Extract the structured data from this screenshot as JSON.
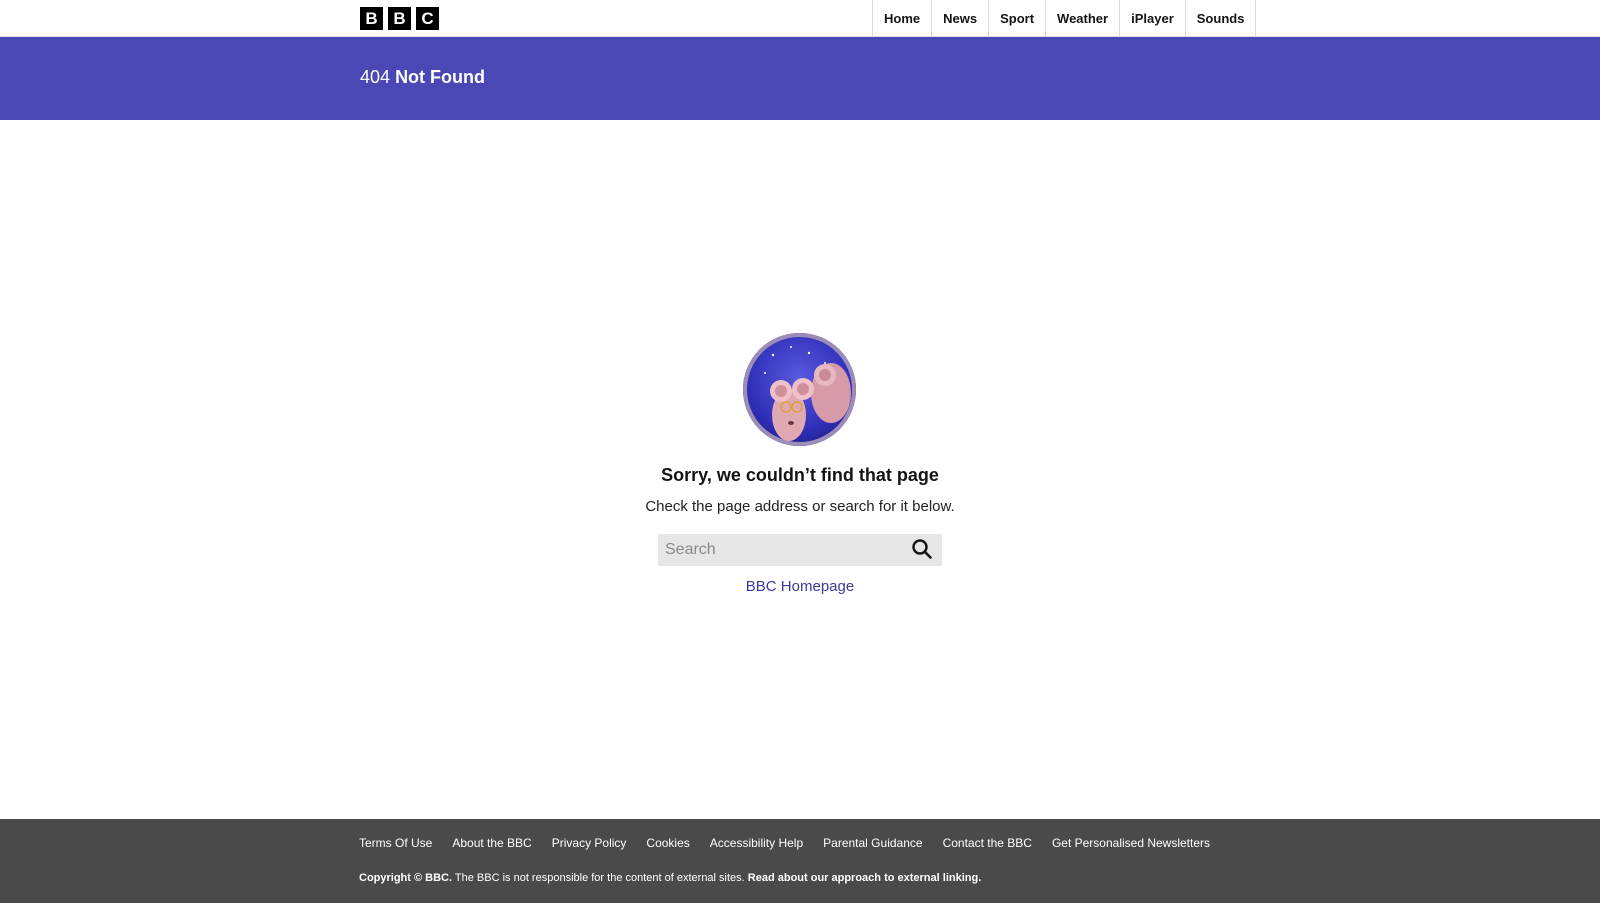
{
  "header": {
    "logo_letters": [
      "B",
      "B",
      "C"
    ],
    "nav": [
      {
        "label": "Home"
      },
      {
        "label": "News"
      },
      {
        "label": "Sport"
      },
      {
        "label": "Weather"
      },
      {
        "label": "iPlayer"
      },
      {
        "label": "Sounds"
      }
    ]
  },
  "banner": {
    "code": "404",
    "title": "Not Found",
    "color": "#4a48b5"
  },
  "main": {
    "image_icon": "mice-illustration",
    "heading": "Sorry, we couldn’t find that page",
    "subtext": "Check the page address or search for it below.",
    "search": {
      "placeholder": "Search",
      "icon": "search-icon"
    },
    "homepage_link": "BBC Homepage",
    "link_color": "#3b3a9e"
  },
  "footer": {
    "links": [
      {
        "label": "Terms Of Use"
      },
      {
        "label": "About the BBC"
      },
      {
        "label": "Privacy Policy"
      },
      {
        "label": "Cookies"
      },
      {
        "label": "Accessibility Help"
      },
      {
        "label": "Parental Guidance"
      },
      {
        "label": "Contact the BBC"
      },
      {
        "label": "Get Personalised Newsletters"
      }
    ],
    "copyright_bold": "Copyright © BBC.",
    "copyright_text": " The BBC is not responsible for the content of external sites. ",
    "external_link": "Read about our approach to external linking.",
    "background": "#4a4a4a"
  }
}
